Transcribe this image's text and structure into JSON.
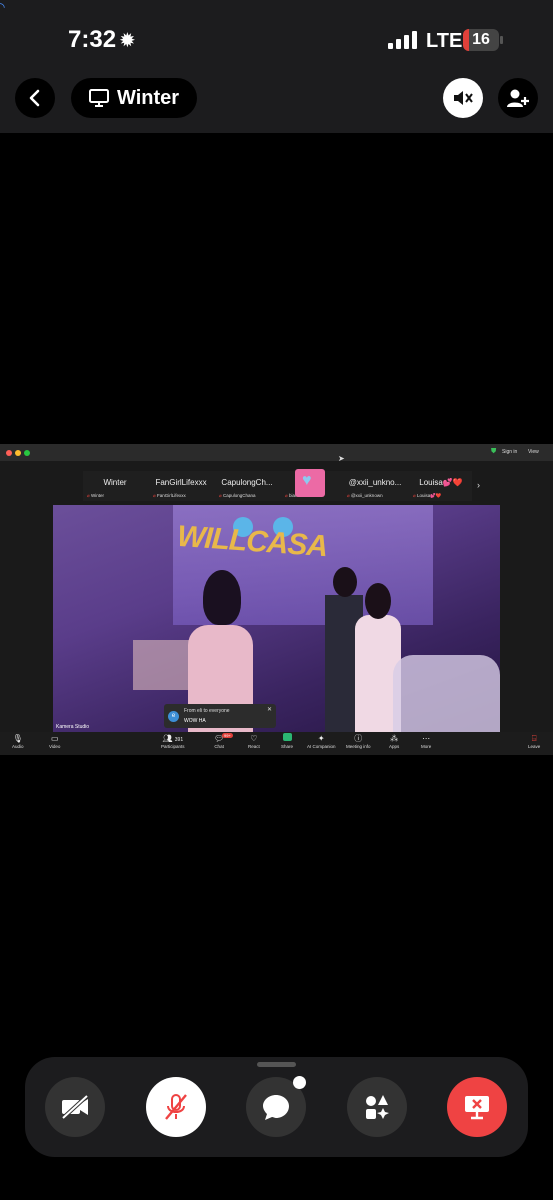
{
  "status_bar": {
    "time": "7:32",
    "network": "LTE",
    "battery": "16",
    "battery_color": "#e0403a"
  },
  "header": {
    "title": "Winter"
  },
  "shared_screen": {
    "top_bar": {
      "signin": "Sign in",
      "view": "View"
    },
    "participants_strip": [
      {
        "name": "Winter",
        "label": "Winter"
      },
      {
        "name": "FanGirlLifexxx",
        "label": "FanGirlLifexxx"
      },
      {
        "name": "CapulongCh...",
        "label": "CapulongChana"
      },
      {
        "name": "",
        "label": "biancswill"
      },
      {
        "name": "@xxii_unkno...",
        "label": "@xxii_unknown"
      },
      {
        "name": "Louisa💕❤️",
        "label": "Louisa💕❤️"
      }
    ],
    "video": {
      "sign_text": "WILLCASA",
      "source_label": "Kamera Studio"
    },
    "chat_popup": {
      "avatar_letter": "e",
      "from": "From eli to everyone",
      "message": "WOW HA"
    },
    "toolbar": {
      "audio": "Audio",
      "video": "Video",
      "participants": "Participants",
      "participants_count": "391",
      "chat": "Chat",
      "chat_badge": "99+",
      "react": "React",
      "share": "Share",
      "ai_companion": "AI Companion",
      "meeting_info": "Meeting info",
      "apps": "Apps",
      "more": "More",
      "leave": "Leave"
    }
  },
  "colors": {
    "accent_red": "#ef4343",
    "share_green": "#2bb673",
    "background": "#000000",
    "bar_background": "#1c1c1e"
  },
  "icons": {
    "back": "chevron-left-icon",
    "title": "monitor-icon",
    "speaker": "speaker-muted-icon",
    "add_participant": "add-person-icon",
    "dock": [
      "camera-off-icon",
      "mic-off-icon",
      "chat-bubble-icon",
      "apps-icon",
      "stop-share-icon"
    ]
  }
}
